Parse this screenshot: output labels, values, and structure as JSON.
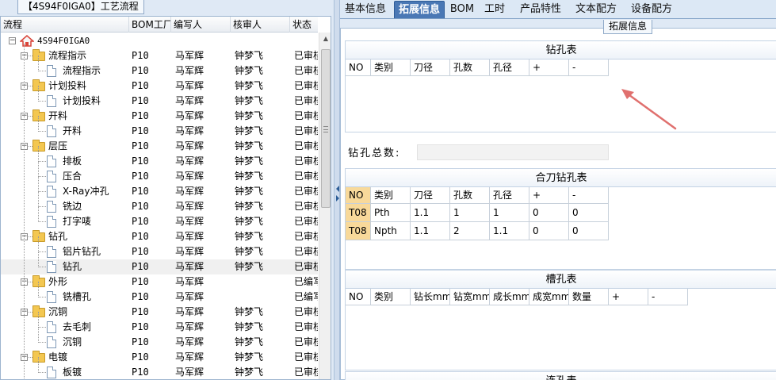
{
  "left": {
    "title": "【4S94F0IGA0】工艺流程",
    "columns": [
      "流程",
      "BOM工厂",
      "编写人",
      "核审人",
      "状态"
    ],
    "root": "4S94F0IGA0",
    "rows": [
      {
        "name": "流程指示",
        "kind": "folder",
        "level": 1,
        "bom": "P10",
        "writer": "马军辉",
        "reviewer": "钟梦飞",
        "status": "已审核"
      },
      {
        "name": "流程指示",
        "kind": "doc",
        "level": 2,
        "bom": "P10",
        "writer": "马军辉",
        "reviewer": "钟梦飞",
        "status": "已审核"
      },
      {
        "name": "计划投料",
        "kind": "folder",
        "level": 1,
        "bom": "P10",
        "writer": "马军辉",
        "reviewer": "钟梦飞",
        "status": "已审核"
      },
      {
        "name": "计划投料",
        "kind": "doc",
        "level": 2,
        "bom": "P10",
        "writer": "马军辉",
        "reviewer": "钟梦飞",
        "status": "已审核"
      },
      {
        "name": "开料",
        "kind": "folder",
        "level": 1,
        "bom": "P10",
        "writer": "马军辉",
        "reviewer": "钟梦飞",
        "status": "已审核"
      },
      {
        "name": "开料",
        "kind": "doc",
        "level": 2,
        "bom": "P10",
        "writer": "马军辉",
        "reviewer": "钟梦飞",
        "status": "已审核"
      },
      {
        "name": "层压",
        "kind": "folder",
        "level": 1,
        "bom": "P10",
        "writer": "马军辉",
        "reviewer": "钟梦飞",
        "status": "已审核"
      },
      {
        "name": "排板",
        "kind": "doc",
        "level": 2,
        "bom": "P10",
        "writer": "马军辉",
        "reviewer": "钟梦飞",
        "status": "已审核"
      },
      {
        "name": "压合",
        "kind": "doc",
        "level": 2,
        "bom": "P10",
        "writer": "马军辉",
        "reviewer": "钟梦飞",
        "status": "已审核"
      },
      {
        "name": "X-Ray冲孔",
        "kind": "doc",
        "level": 2,
        "bom": "P10",
        "writer": "马军辉",
        "reviewer": "钟梦飞",
        "status": "已审核"
      },
      {
        "name": "铣边",
        "kind": "doc",
        "level": 2,
        "bom": "P10",
        "writer": "马军辉",
        "reviewer": "钟梦飞",
        "status": "已审核"
      },
      {
        "name": "打字唛",
        "kind": "doc",
        "level": 2,
        "bom": "P10",
        "writer": "马军辉",
        "reviewer": "钟梦飞",
        "status": "已审核"
      },
      {
        "name": "钻孔",
        "kind": "folder",
        "level": 1,
        "bom": "P10",
        "writer": "马军辉",
        "reviewer": "钟梦飞",
        "status": "已审核"
      },
      {
        "name": "铝片钻孔",
        "kind": "doc",
        "level": 2,
        "bom": "P10",
        "writer": "马军辉",
        "reviewer": "钟梦飞",
        "status": "已审核"
      },
      {
        "name": "钻孔",
        "kind": "doc",
        "level": 2,
        "bom": "P10",
        "writer": "马军辉",
        "reviewer": "钟梦飞",
        "status": "已审核",
        "selected": true
      },
      {
        "name": "外形",
        "kind": "folder",
        "level": 1,
        "bom": "P10",
        "writer": "马军辉",
        "reviewer": "",
        "status": "已编写"
      },
      {
        "name": "铣槽孔",
        "kind": "doc",
        "level": 2,
        "bom": "P10",
        "writer": "马军辉",
        "reviewer": "",
        "status": "已编写"
      },
      {
        "name": "沉铜",
        "kind": "folder",
        "level": 1,
        "bom": "P10",
        "writer": "马军辉",
        "reviewer": "钟梦飞",
        "status": "已审核"
      },
      {
        "name": "去毛刺",
        "kind": "doc",
        "level": 2,
        "bom": "P10",
        "writer": "马军辉",
        "reviewer": "钟梦飞",
        "status": "已审核"
      },
      {
        "name": "沉铜",
        "kind": "doc",
        "level": 2,
        "bom": "P10",
        "writer": "马军辉",
        "reviewer": "钟梦飞",
        "status": "已审核"
      },
      {
        "name": "电镀",
        "kind": "folder",
        "level": 1,
        "bom": "P10",
        "writer": "马军辉",
        "reviewer": "钟梦飞",
        "status": "已审核"
      },
      {
        "name": "板镀",
        "kind": "doc",
        "level": 2,
        "bom": "P10",
        "writer": "马军辉",
        "reviewer": "钟梦飞",
        "status": "已审核"
      }
    ]
  },
  "tabs": [
    "基本信息",
    "拓展信息",
    "BOM",
    "工时",
    "产品特性",
    "文本配方",
    "设备配方"
  ],
  "active_tab": "拓展信息",
  "panel_title": "拓展信息",
  "drill_table": {
    "title": "钻孔表",
    "columns": [
      "NO",
      "类别",
      "刀径",
      "孔数",
      "孔径",
      "+",
      "-"
    ]
  },
  "drill_count": {
    "label": "钻孔总数:",
    "value": ""
  },
  "combo_table": {
    "title": "合刀钻孔表",
    "columns": [
      "NO",
      "类别",
      "刀径",
      "孔数",
      "孔径",
      "+",
      "-"
    ],
    "rows": [
      [
        "T08",
        "Pth",
        "1.1",
        "1",
        "1",
        "0",
        "0"
      ],
      [
        "T08",
        "Npth",
        "1.1",
        "2",
        "1.1",
        "0",
        "0"
      ]
    ]
  },
  "slot_table": {
    "title": "槽孔表",
    "columns": [
      "NO",
      "类别",
      "钻长mm",
      "钻宽mm",
      "成长mm",
      "成宽mm",
      "数量",
      "+",
      "-"
    ]
  },
  "next_table": {
    "title": "连孔表"
  },
  "colors": {
    "accent_tab": "#4a78b5",
    "highlight": "#f8d99a",
    "arrow": "#e0706e",
    "home": "#d9453a",
    "folder": "#f3c751"
  }
}
